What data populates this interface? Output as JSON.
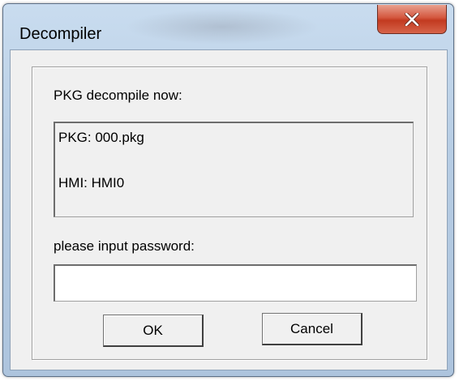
{
  "window": {
    "title": "Decompiler",
    "close_icon": "close-x-icon"
  },
  "dialog": {
    "status_label": "PKG decompile now:",
    "info": {
      "pkg_line": "PKG:  000.pkg",
      "hmi_line": "HMI:  HMI0"
    },
    "password_label": "please input password:",
    "password_value": "",
    "ok_label": "OK",
    "cancel_label": "Cancel"
  },
  "colors": {
    "title_bar": "#b7cde4",
    "close_button": "#c94a30",
    "client_bg": "#f0f0f0"
  }
}
